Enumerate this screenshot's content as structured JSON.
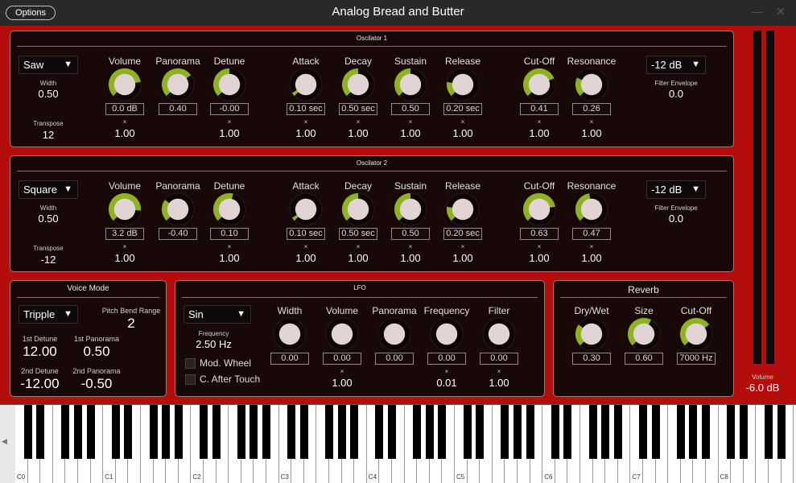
{
  "window": {
    "title": "Analog Bread and Butter",
    "options_label": "Options",
    "minimize_glyph": "—",
    "close_glyph": "✕"
  },
  "oscillators": [
    {
      "title": "Oscilator 1",
      "waveform": "Saw",
      "width_label": "Width",
      "width_value": "0.50",
      "transpose_label": "Transpose",
      "transpose_value": "12",
      "filter_slope": "-12 dB",
      "filter_env_label": "Filter Envelope",
      "filter_env_value": "0.0",
      "knobs": [
        {
          "label": "Volume",
          "value": "0.0 dB",
          "mult": "1.00",
          "level": 0.8
        },
        {
          "label": "Panorama",
          "value": "0.40",
          "level": 0.7
        },
        {
          "label": "Detune",
          "value": "-0.00",
          "mult": "1.00",
          "level": 0.5
        },
        {
          "label": "Attack",
          "value": "0.10 sec",
          "mult": "1.00",
          "level": 0.05
        },
        {
          "label": "Decay",
          "value": "0.50 sec",
          "mult": "1.00",
          "level": 0.5
        },
        {
          "label": "Sustain",
          "value": "0.50",
          "mult": "1.00",
          "level": 0.5
        },
        {
          "label": "Release",
          "value": "0.20 sec",
          "mult": "1.00",
          "level": 0.2
        },
        {
          "label": "Cut-Off",
          "value": "0.41",
          "mult": "1.00",
          "level": 0.75
        },
        {
          "label": "Resonance",
          "value": "0.26",
          "mult": "1.00",
          "level": 0.26
        }
      ]
    },
    {
      "title": "Oscilator 2",
      "waveform": "Square",
      "width_label": "Width",
      "width_value": "0.50",
      "transpose_label": "Transpose",
      "transpose_value": "-12",
      "filter_slope": "-12 dB",
      "filter_env_label": "Filter Envelope",
      "filter_env_value": "0.0",
      "knobs": [
        {
          "label": "Volume",
          "value": "3.2 dB",
          "mult": "1.00",
          "level": 0.85
        },
        {
          "label": "Panorama",
          "value": "-0.40",
          "level": 0.3
        },
        {
          "label": "Detune",
          "value": "0.10",
          "mult": "1.00",
          "level": 0.55
        },
        {
          "label": "Attack",
          "value": "0.10 sec",
          "mult": "1.00",
          "level": 0.05
        },
        {
          "label": "Decay",
          "value": "0.50 sec",
          "mult": "1.00",
          "level": 0.5
        },
        {
          "label": "Sustain",
          "value": "0.50",
          "mult": "1.00",
          "level": 0.5
        },
        {
          "label": "Release",
          "value": "0.20 sec",
          "mult": "1.00",
          "level": 0.2
        },
        {
          "label": "Cut-Off",
          "value": "0.63",
          "mult": "1.00",
          "level": 0.8
        },
        {
          "label": "Resonance",
          "value": "0.47",
          "mult": "1.00",
          "level": 0.47
        }
      ]
    }
  ],
  "voice_mode": {
    "title": "Voice Mode",
    "mode": "Tripple",
    "pitch_bend_label": "Pitch Bend Range",
    "pitch_bend_value": "2",
    "detune1_label": "1st Detune",
    "detune1_value": "12.00",
    "pan1_label": "1st Panorama",
    "pan1_value": "0.50",
    "detune2_label": "2nd Detune",
    "detune2_value": "-12.00",
    "pan2_label": "2nd Panorama",
    "pan2_value": "-0.50"
  },
  "lfo": {
    "title": "LFO",
    "waveform": "Sin",
    "frequency_label": "Frequency",
    "frequency_value": "2.50 Hz",
    "mod_wheel_label": "Mod. Wheel",
    "after_touch_label": "C. After Touch",
    "knobs": [
      {
        "label": "Width",
        "value": "0.00",
        "level": 0.0
      },
      {
        "label": "Volume",
        "value": "0.00",
        "mult": "1.00",
        "level": 0.0
      },
      {
        "label": "Panorama",
        "value": "0.00",
        "level": 0.0
      },
      {
        "label": "Frequency",
        "value": "0.00",
        "mult": "0.01",
        "level": 0.0
      },
      {
        "label": "Filter",
        "value": "0.00",
        "mult": "1.00",
        "level": 0.0
      }
    ]
  },
  "reverb": {
    "title": "Reverb",
    "knobs": [
      {
        "label": "Dry/Wet",
        "value": "0.30",
        "level": 0.3
      },
      {
        "label": "Size",
        "value": "0.60",
        "level": 0.6
      },
      {
        "label": "Cut-Off",
        "value": "7000 Hz",
        "level": 0.7
      }
    ]
  },
  "master": {
    "volume_label": "Volume",
    "volume_value": "-6.0 dB"
  },
  "keyboard": {
    "octave_labels": [
      "C0",
      "C1",
      "C2",
      "C3",
      "C4",
      "C5",
      "C6",
      "C7",
      "C8"
    ],
    "scroll_glyph": "◀"
  },
  "mult_glyph": "×",
  "combo_arrow": "▼",
  "colors": {
    "accent": "#8fb320",
    "knob_body": "#e2d4d4",
    "background": "#b50c0c",
    "panel": "#190808"
  }
}
